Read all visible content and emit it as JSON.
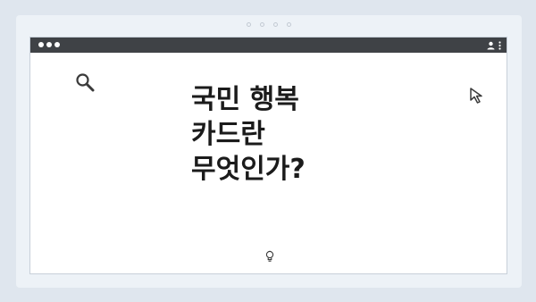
{
  "pager": {
    "dot_count": 4
  },
  "window": {
    "traffic_lights": [
      "close",
      "minimize",
      "maximize"
    ],
    "menu_icons": [
      "user-icon",
      "kebab-menu-icon"
    ]
  },
  "content": {
    "heading": "국민 행복\n카드란\n무엇인가?",
    "icons": [
      "search-icon",
      "cursor-icon",
      "lightbulb-icon"
    ]
  },
  "colors": {
    "background": "#dfe6ee",
    "frame": "#edf2f7",
    "titlebar": "#3f4246",
    "window": "#ffffff",
    "text": "#1b1b1b",
    "icon_stroke": "#3a3a3a"
  }
}
